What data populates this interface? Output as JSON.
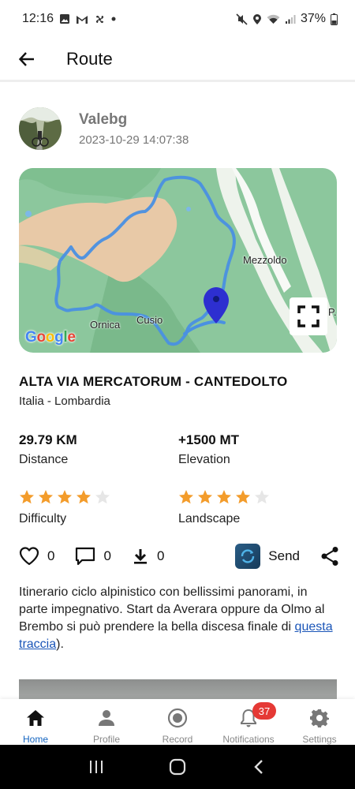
{
  "status_bar": {
    "time": "12:16",
    "battery": "37%"
  },
  "header": {
    "title": "Route"
  },
  "author": {
    "name": "Valebg",
    "date": "2023-10-29 14:07:38"
  },
  "map": {
    "labels": {
      "mezzoldo": "Mezzoldo",
      "ornica": "Ornica",
      "cusio": "Cusio",
      "edge": "P...orr"
    },
    "logo": {
      "g1": "G",
      "o1": "o",
      "o2": "o",
      "g2": "g",
      "l": "l",
      "e": "e"
    },
    "colors": {
      "route": "#4a90e2",
      "marker": "#2d2fd0"
    }
  },
  "route": {
    "title": "ALTA VIA MERCATORUM - CANTEDOLTO",
    "region": "Italia - Lombardia"
  },
  "stats": {
    "distance": {
      "value": "29.79 KM",
      "label": "Distance"
    },
    "elevation": {
      "value": "+1500 MT",
      "label": "Elevation"
    }
  },
  "ratings": {
    "difficulty": {
      "label": "Difficulty",
      "score": 4,
      "max": 5
    },
    "landscape": {
      "label": "Landscape",
      "score": 4,
      "max": 5
    },
    "colors": {
      "filled": "#f39c2b",
      "empty": "#e6e6e6"
    }
  },
  "actions": {
    "likes": "0",
    "comments": "0",
    "downloads": "0",
    "send_label": "Send"
  },
  "description": {
    "text": "Itinerario ciclo alpinistico con bellissimi panorami, in parte impegnativo. Start da Averara oppure da Olmo al Brembo si può prendere la bella discesa finale di ",
    "link": "questa traccia",
    "suffix": ")."
  },
  "bottom_nav": {
    "home": "Home",
    "profile": "Profile",
    "record": "Record",
    "notifications": "Notifications",
    "settings": "Settings",
    "notifications_badge": "37",
    "active": "home"
  }
}
